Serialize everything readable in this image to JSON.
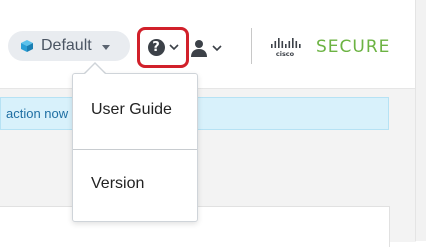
{
  "header": {
    "domain_selector": {
      "label": "Default",
      "icon": "cube-icon",
      "icon_color": "#2a9fd6"
    },
    "help_button": {
      "icon": "question-circle-icon",
      "highlight_color": "#d1202a"
    },
    "user_button": {
      "icon": "user-icon"
    },
    "brand": {
      "logo": "cisco-logo",
      "product": "SECURE",
      "product_color": "#6cb343"
    }
  },
  "alert": {
    "text": "action now"
  },
  "help_menu": {
    "items": [
      {
        "label": "User Guide"
      },
      {
        "label": "Version"
      }
    ]
  }
}
